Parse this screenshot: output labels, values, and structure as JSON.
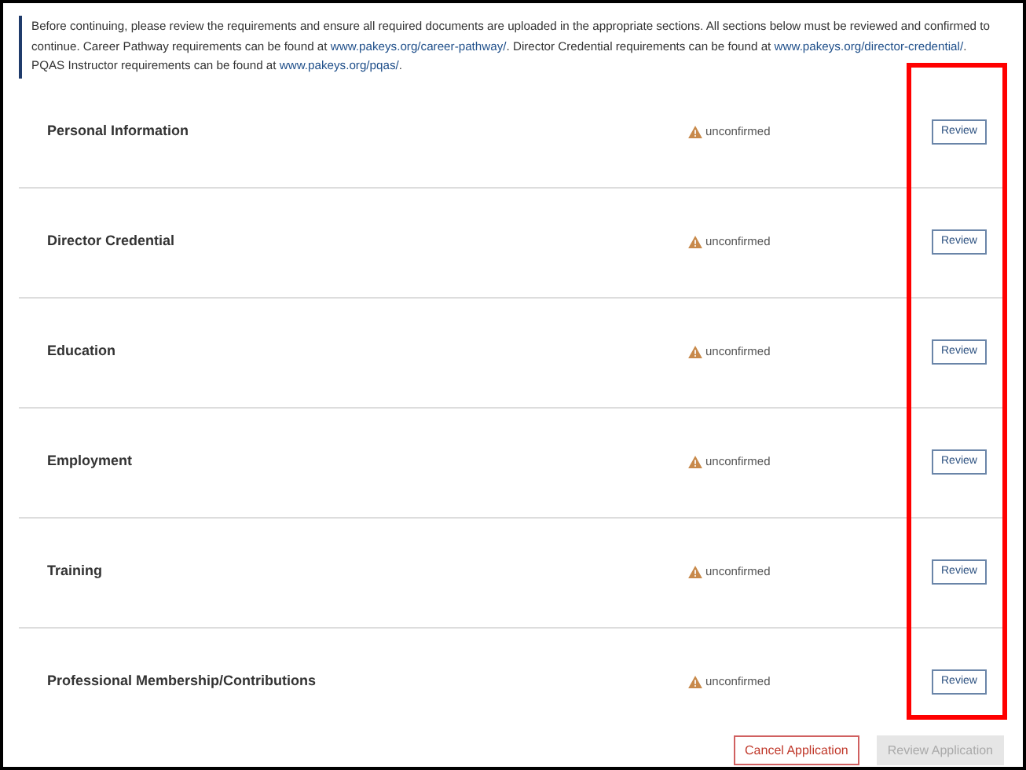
{
  "notice": [
    {
      "kind": "text",
      "text": "Before continuing, please review the requirements and ensure all required documents are uploaded in the appropriate sections. All sections below must be reviewed and confirmed to continue. Career Pathway requirements can be found at "
    },
    {
      "kind": "link",
      "text": "www.pakeys.org/career-pathway/"
    },
    {
      "kind": "text",
      "text": ". Director Credential requirements can be found at "
    },
    {
      "kind": "link",
      "text": "www.pakeys.org/director-credential/"
    },
    {
      "kind": "text",
      "text": ". PQAS Instructor requirements can be found at "
    },
    {
      "kind": "link",
      "text": "www.pakeys.org/pqas/"
    },
    {
      "kind": "text",
      "text": "."
    }
  ],
  "sections": [
    {
      "name": "Personal Information",
      "status": "unconfirmed",
      "button": "Review"
    },
    {
      "name": "Director Credential",
      "status": "unconfirmed",
      "button": "Review"
    },
    {
      "name": "Education",
      "status": "unconfirmed",
      "button": "Review"
    },
    {
      "name": "Employment",
      "status": "unconfirmed",
      "button": "Review"
    },
    {
      "name": "Training",
      "status": "unconfirmed",
      "button": "Review"
    },
    {
      "name": "Professional Membership/Contributions",
      "status": "unconfirmed",
      "button": "Review"
    }
  ],
  "footer": [
    {
      "label": "Cancel Application",
      "disabled": false,
      "kind": "danger"
    },
    {
      "label": "Review Application",
      "disabled": true,
      "kind": "primary"
    }
  ]
}
